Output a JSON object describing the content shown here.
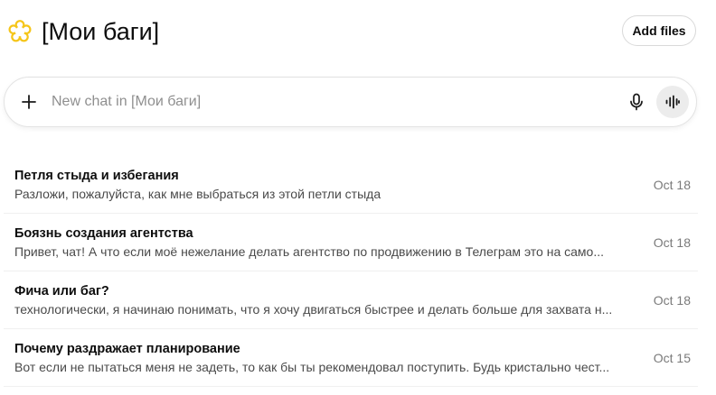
{
  "project": {
    "title": "[Мои баги]",
    "icon": "flower-icon",
    "icon_color": "#f5c518"
  },
  "header": {
    "add_files_label": "Add files"
  },
  "composer": {
    "placeholder": "New chat in [Мои баги]",
    "plus_icon": "plus-icon",
    "mic_icon": "microphone-icon",
    "voice_icon": "voice-mode-icon"
  },
  "chats": [
    {
      "title": "Петля стыда и избегания",
      "preview": "Разложи, пожалуйста, как мне выбраться из этой петли стыда",
      "date": "Oct 18"
    },
    {
      "title": "Боязнь создания агентства",
      "preview": "Привет, чат! А что если моё нежелание делать агентство по продвижению в Телеграм это на само...",
      "date": "Oct 18"
    },
    {
      "title": "Фича или баг?",
      "preview": "технологически, я начинаю понимать, что я хочу двигаться быстрее и делать больше для захвата н...",
      "date": "Oct 18"
    },
    {
      "title": "Почему раздражает планирование",
      "preview": "Вот если не пытаться меня не задеть, то как бы ты рекомендовал поступить. Будь кристально чест...",
      "date": "Oct 15"
    }
  ]
}
